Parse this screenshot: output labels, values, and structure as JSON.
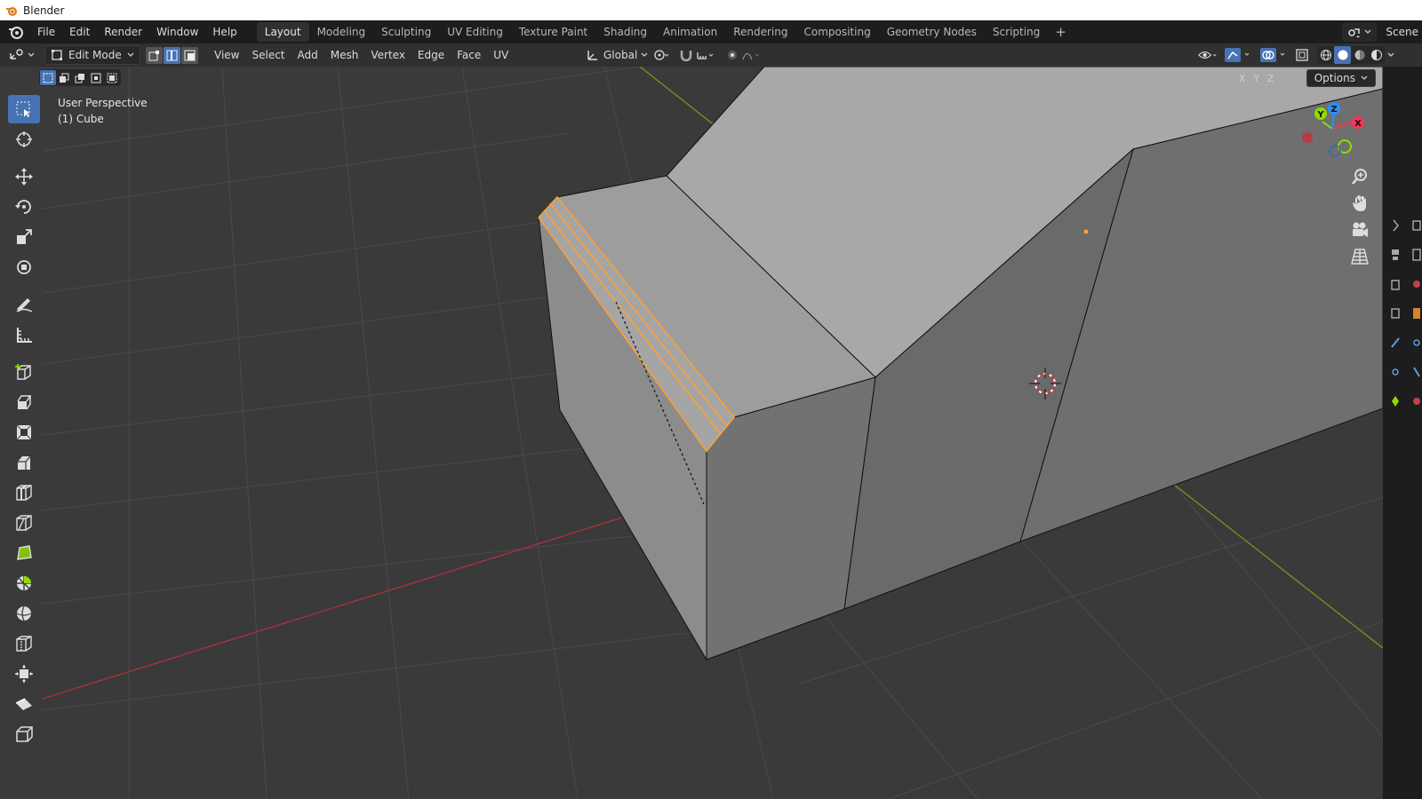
{
  "window": {
    "title": "Blender"
  },
  "topbar": {
    "menus": [
      "File",
      "Edit",
      "Render",
      "Window",
      "Help"
    ],
    "workspaces": [
      "Layout",
      "Modeling",
      "Sculpting",
      "UV Editing",
      "Texture Paint",
      "Shading",
      "Animation",
      "Rendering",
      "Compositing",
      "Geometry Nodes",
      "Scripting"
    ],
    "active_workspace": "Layout",
    "add_workspace": "+",
    "scene": "Scene"
  },
  "viewport_header": {
    "mode": "Edit Mode",
    "menus": [
      "View",
      "Select",
      "Add",
      "Mesh",
      "Vertex",
      "Edge",
      "Face",
      "UV"
    ],
    "orientation": "Global",
    "active_select_mode": "edge"
  },
  "viewport": {
    "perspective": "User Perspective",
    "object": "(1) Cube",
    "axis_labels": [
      "X",
      "Y",
      "Z"
    ],
    "options_label": "Options"
  },
  "gizmo": {
    "x": "X",
    "y": "Y",
    "z": "Z"
  },
  "colors": {
    "accent": "#4772b3",
    "selection": "#ffa033",
    "x_axis": "#ff3352",
    "y_axis": "#8bdc00",
    "z_axis": "#2890ff"
  },
  "tools": [
    "select-box-tool",
    "cursor-tool",
    "move-tool",
    "rotate-tool",
    "scale-tool",
    "transform-tool",
    "annotate-tool",
    "measure-tool",
    "add-cube-tool",
    "extrude-region-tool",
    "inset-faces-tool",
    "bevel-tool",
    "loop-cut-tool",
    "knife-tool",
    "poly-build-tool",
    "spin-tool",
    "smooth-tool",
    "edge-slide-tool",
    "shrink-fatten-tool",
    "shear-tool",
    "rip-region-tool"
  ]
}
